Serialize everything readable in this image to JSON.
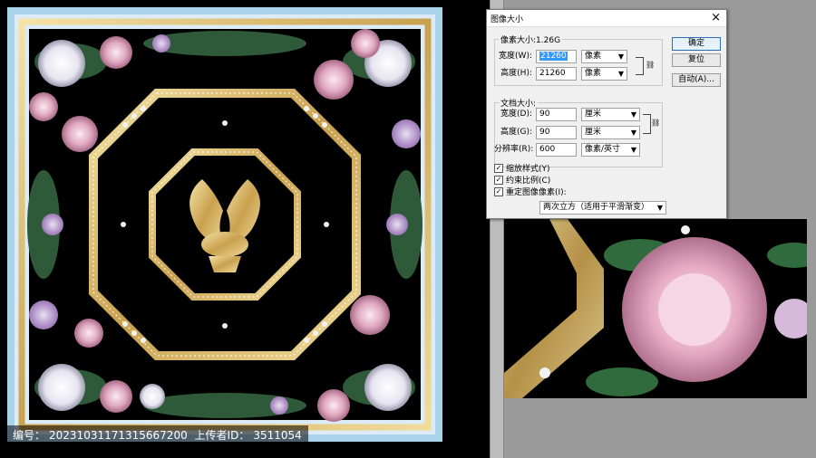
{
  "dialog": {
    "title": "图像大小",
    "close_icon": "×",
    "pixel_dimensions": {
      "legend": "像素大小:1.26G",
      "width_label": "宽度(W):",
      "width_value": "21260",
      "width_unit": "像素",
      "height_label": "高度(H):",
      "height_value": "21260",
      "height_unit": "像素"
    },
    "document_size": {
      "legend": "文档大小:",
      "width_label": "宽度(D):",
      "width_value": "90",
      "width_unit": "厘米",
      "height_label": "高度(G):",
      "height_value": "90",
      "height_unit": "厘米",
      "resolution_label": "分辨率(R):",
      "resolution_value": "600",
      "resolution_unit": "像素/英寸"
    },
    "buttons": {
      "ok": "确定",
      "reset": "复位",
      "auto": "自动(A)..."
    },
    "checkboxes": {
      "scale_styles": "缩放样式(Y)",
      "constrain": "约束比例(C)",
      "resample": "重定图像像素(I):"
    },
    "resample_method": "两次立方（适用于平滑渐变）"
  },
  "watermark": {
    "id_label": "编号：",
    "id_value": "20231031171315667200",
    "uploader_label": "上传者ID：",
    "uploader_value": "3511054"
  },
  "colors": {
    "scarf_border": "#a9d3ea",
    "gold": "#d8b86a",
    "black": "#000000"
  }
}
